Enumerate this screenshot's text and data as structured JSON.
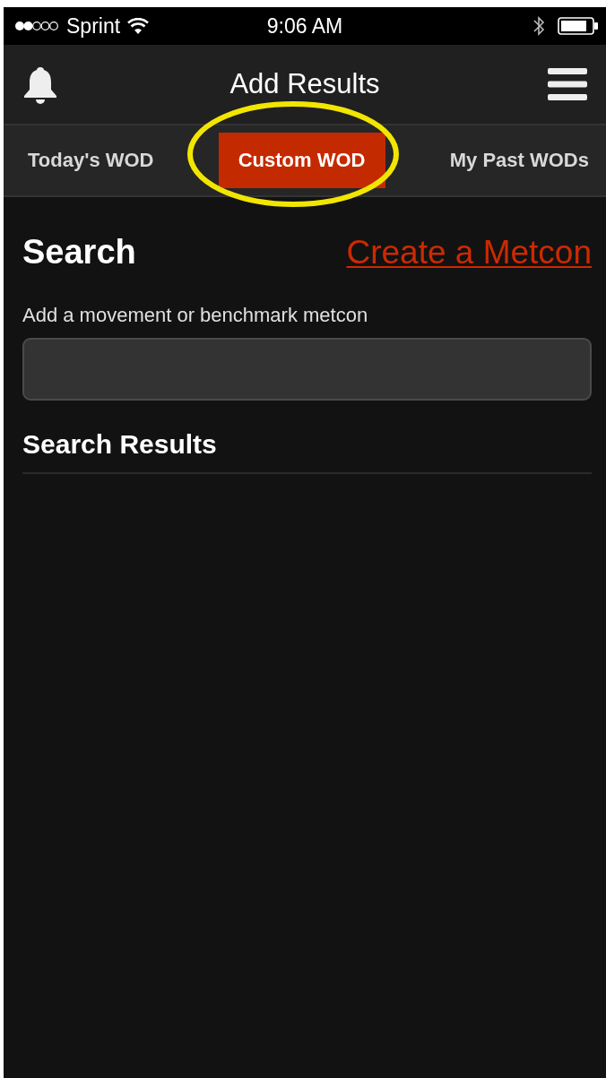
{
  "status_bar": {
    "carrier": "Sprint",
    "time": "9:06 AM"
  },
  "nav_bar": {
    "title": "Add Results"
  },
  "tabs": [
    {
      "label": "Today's WOD",
      "selected": false
    },
    {
      "label": "Custom WOD",
      "selected": true
    },
    {
      "label": "My Past WODs",
      "selected": false
    }
  ],
  "annotation": {
    "kind": "ellipse"
  },
  "search": {
    "heading": "Search",
    "link": "Create a Metcon",
    "field_label": "Add a movement or benchmark metcon"
  },
  "results": {
    "heading": "Search Results"
  }
}
